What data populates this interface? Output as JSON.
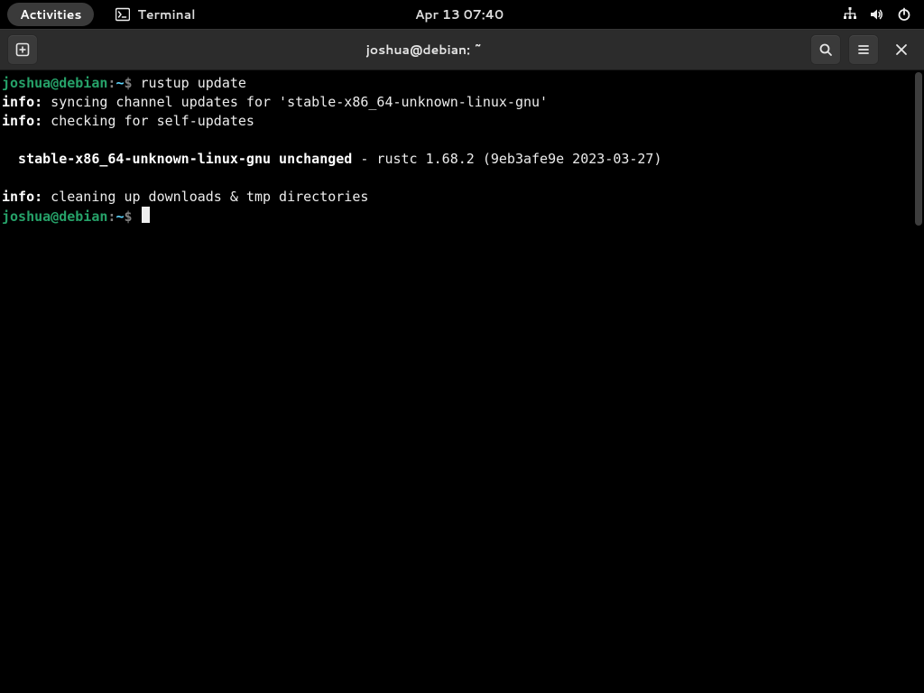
{
  "topbar": {
    "activities": "Activities",
    "app_name": "Terminal",
    "clock": "Apr 13  07:40"
  },
  "window": {
    "title": "joshua@debian: ~"
  },
  "prompt": {
    "userhost": "joshua@debian",
    "sep": ":",
    "path": "~",
    "dollar": "$"
  },
  "lines": {
    "cmd1": " rustup update",
    "info_label": "info:",
    "info1_rest": " syncing channel updates for 'stable-x86_64-unknown-linux-gnu'",
    "info2_rest": " checking for self-updates",
    "status_bold": "  stable-x86_64-unknown-linux-gnu unchanged",
    "status_rest": " - rustc 1.68.2 (9eb3afe9e 2023-03-27)",
    "info3_rest": " cleaning up downloads & tmp directories"
  }
}
